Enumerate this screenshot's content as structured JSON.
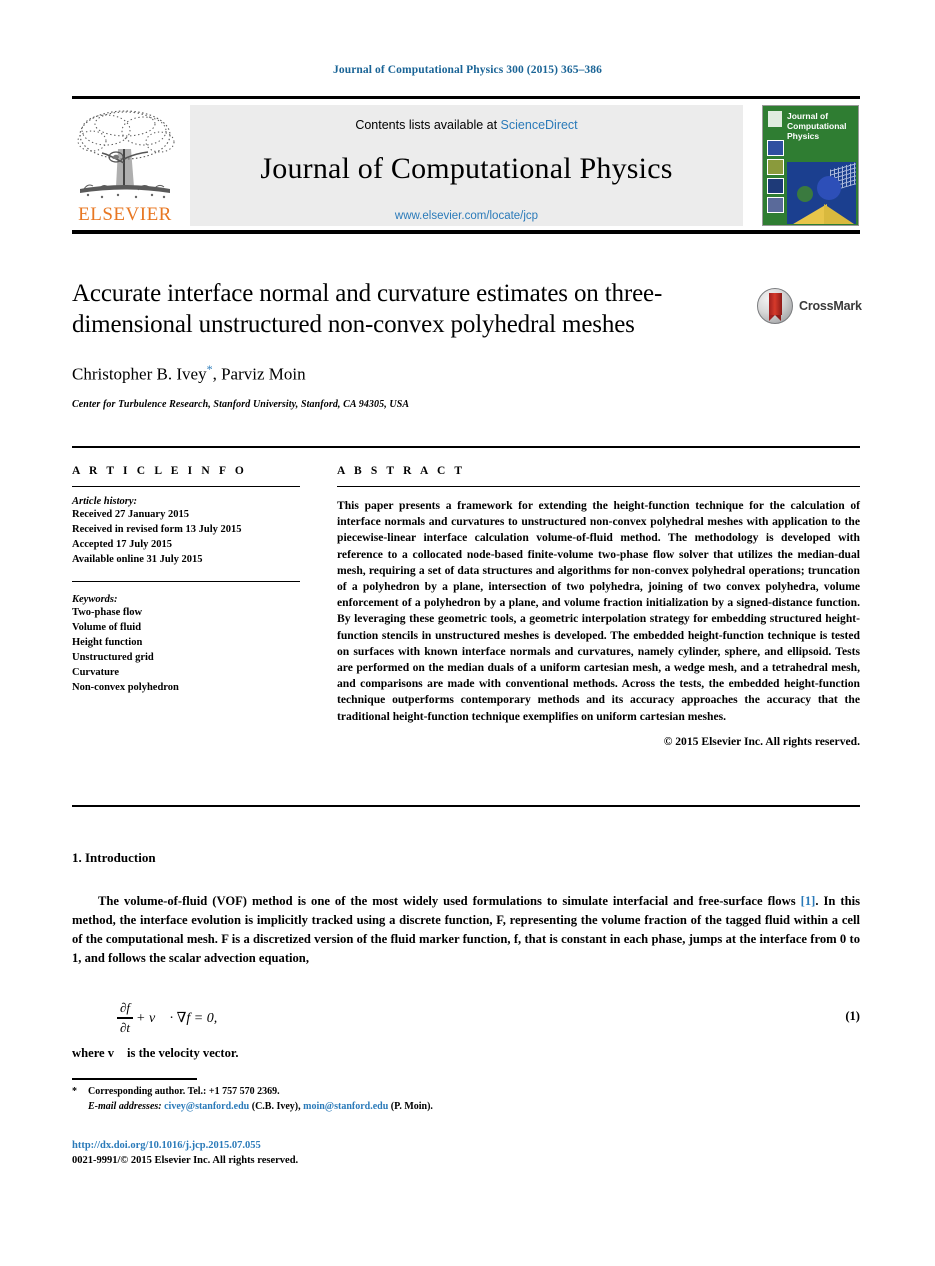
{
  "running_head": "Journal of Computational Physics 300 (2015) 365–386",
  "masthead": {
    "publisher_name": "ELSEVIER",
    "contents_prefix": "Contents lists available at ",
    "contents_link": "ScienceDirect",
    "journal_title": "Journal of Computational Physics",
    "journal_url": "www.elsevier.com/locate/jcp",
    "cover_title": "Journal of Computational Physics"
  },
  "article": {
    "title": "Accurate interface normal and curvature estimates on three-dimensional unstructured non-convex polyhedral meshes",
    "authors": "Christopher B. Ivey",
    "authors_tail": ", Parviz Moin",
    "corresponding_marker": "*",
    "affiliation": "Center for Turbulence Research, Stanford University, Stanford, CA 94305, USA",
    "crossmark_label": "CrossMark"
  },
  "article_info": {
    "heading": "A R T I C L E    I N F O",
    "history_label": "Article history:",
    "history": [
      "Received 27 January 2015",
      "Received in revised form 13 July 2015",
      "Accepted 17 July 2015",
      "Available online 31 July 2015"
    ],
    "keywords_label": "Keywords:",
    "keywords": [
      "Two-phase flow",
      "Volume of fluid",
      "Height function",
      "Unstructured grid",
      "Curvature",
      "Non-convex polyhedron"
    ]
  },
  "abstract": {
    "heading": "A B S T R A C T",
    "body": "This paper presents a framework for extending the height-function technique for the calculation of interface normals and curvatures to unstructured non-convex polyhedral meshes with application to the piecewise-linear interface calculation volume-of-fluid method. The methodology is developed with reference to a collocated node-based finite-volume two-phase flow solver that utilizes the median-dual mesh, requiring a set of data structures and algorithms for non-convex polyhedral operations; truncation of a polyhedron by a plane, intersection of two polyhedra, joining of two convex polyhedra, volume enforcement of a polyhedron by a plane, and volume fraction initialization by a signed-distance function. By leveraging these geometric tools, a geometric interpolation strategy for embedding structured height-function stencils in unstructured meshes is developed. The embedded height-function technique is tested on surfaces with known interface normals and curvatures, namely cylinder, sphere, and ellipsoid. Tests are performed on the median duals of a uniform cartesian mesh, a wedge mesh, and a tetrahedral mesh, and comparisons are made with conventional methods. Across the tests, the embedded height-function technique outperforms contemporary methods and its accuracy approaches the accuracy that the traditional height-function technique exemplifies on uniform cartesian meshes.",
    "copyright": "© 2015 Elsevier Inc. All rights reserved."
  },
  "introduction": {
    "heading": "1. Introduction",
    "para_part1": "The volume-of-fluid (VOF) method is one of the most widely used formulations to simulate interfacial and free-surface flows ",
    "citation": "[1]",
    "para_part2": ". In this method, the interface evolution is implicitly tracked using a discrete function, F, representing the volume fraction of the tagged fluid within a cell of the computational mesh. F is a discretized version of the fluid marker function, f, that is constant in each phase, jumps at the interface from 0 to 1, and follows the scalar advection equation,",
    "equation": {
      "num_symbol": "∂f",
      "den_symbol": "∂t",
      "rest": "+ v⃗ · ∇f = 0,",
      "number": "(1)"
    },
    "after_equation": "where v⃗ is the velocity vector."
  },
  "footnotes": {
    "corresponding": "Corresponding author. Tel.: +1 757 570 2369.",
    "email_label": "E-mail addresses:",
    "email1": "civey@stanford.edu",
    "email1_owner": "(C.B. Ivey),",
    "email2": "moin@stanford.edu",
    "email2_owner": "(P. Moin).",
    "doi": "http://dx.doi.org/10.1016/j.jcp.2015.07.055",
    "issn_line": "0021-9991/© 2015 Elsevier Inc. All rights reserved."
  },
  "colors": {
    "link_blue": "#2a7ab9",
    "head_blue": "#1a6496",
    "elsevier_orange": "#E87722",
    "cover_green": "#2f7d32",
    "banner_gray": "#ececec"
  }
}
